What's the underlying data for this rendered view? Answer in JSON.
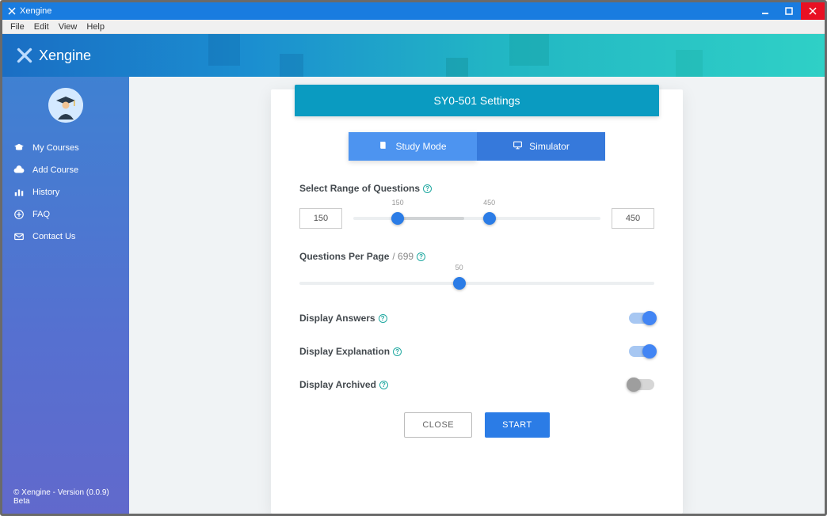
{
  "window_title": "Xengine",
  "menubar": [
    "File",
    "Edit",
    "View",
    "Help"
  ],
  "brand": "Xengine",
  "sidebar": {
    "items": [
      {
        "icon": "graduation-cap-icon",
        "label": "My Courses"
      },
      {
        "icon": "cloud-icon",
        "label": "Add Course"
      },
      {
        "icon": "chart-icon",
        "label": "History"
      },
      {
        "icon": "plus-circle-icon",
        "label": "FAQ"
      },
      {
        "icon": "envelope-icon",
        "label": "Contact Us"
      }
    ]
  },
  "copyright": "© Xengine - Version (0.0.9) Beta",
  "settings": {
    "title": "SY0-501 Settings",
    "tabs": {
      "study": "Study Mode",
      "simulator": "Simulator"
    },
    "range_label": "Select Range of Questions",
    "range_min": "150",
    "range_max": "450",
    "range_min_tip": "150",
    "range_max_tip": "450",
    "per_page_label": "Questions Per Page",
    "per_page_total": "/ 699",
    "per_page_value": "50",
    "toggles": {
      "answers": "Display Answers",
      "explanation": "Display Explanation",
      "archived": "Display Archived"
    },
    "close": "CLOSE",
    "start": "START"
  }
}
